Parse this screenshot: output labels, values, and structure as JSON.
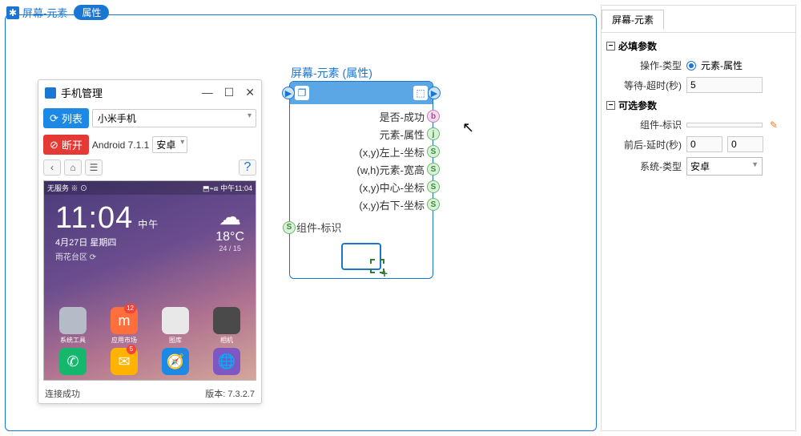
{
  "tab": {
    "label": "屏幕-元素",
    "pill": "属性"
  },
  "phone_window": {
    "title": "手机管理",
    "list_btn": "列表",
    "disconnect_btn": "断开",
    "device_select": "小米手机",
    "os_text": "Android 7.1.1",
    "platform_select": "安卓",
    "footer_status": "连接成功",
    "footer_version": "版本: 7.3.2.7"
  },
  "screen": {
    "status_left": "无服务 ※ ⊙",
    "status_right": "⬒⌁⧈ 中午11:04",
    "time": "11:04",
    "ampm": "中午",
    "date": "4月27日 星期四",
    "location": "雨花台区 ⟳",
    "temp": "18°C",
    "temp_range": "24 / 15",
    "apps_row1": [
      {
        "label": "系统工具",
        "color": "#b5bcc7",
        "badge": ""
      },
      {
        "label": "应用市场",
        "color": "#ff6f3c",
        "badge": "12",
        "text": "m"
      },
      {
        "label": "图库",
        "color": "#e8e8e8",
        "badge": ""
      },
      {
        "label": "相机",
        "color": "#4a4a4a",
        "badge": ""
      }
    ],
    "apps_row2": [
      {
        "label": "",
        "color": "#15b76c",
        "badge": "",
        "icon": "phone"
      },
      {
        "label": "",
        "color": "#ffb300",
        "badge": "5",
        "icon": "msg"
      },
      {
        "label": "",
        "color": "#1e88e5",
        "badge": "",
        "icon": "browser"
      },
      {
        "label": "",
        "color": "#7e57c2",
        "badge": "",
        "icon": "globe"
      }
    ]
  },
  "node": {
    "title": "屏幕-元素 (属性)",
    "outputs": [
      {
        "label": "是否-成功",
        "type": "b"
      },
      {
        "label": "元素-属性",
        "type": "j"
      },
      {
        "label": "(x,y)左上-坐标",
        "type": "S"
      },
      {
        "label": "(w,h)元素-宽高",
        "type": "S"
      },
      {
        "label": "(x,y)中心-坐标",
        "type": "S"
      },
      {
        "label": "(x,y)右下-坐标",
        "type": "S"
      }
    ],
    "input_label": "组件-标识"
  },
  "props": {
    "tab": "屏幕-元素",
    "required_section": "必填参数",
    "optional_section": "可选参数",
    "operation_type_label": "操作-类型",
    "operation_type_value": "元素-属性",
    "wait_timeout_label": "等待-超时(秒)",
    "wait_timeout_value": "5",
    "component_id_label": "组件-标识",
    "component_id_value": "",
    "delay_label": "前后-延时(秒)",
    "delay_before": "0",
    "delay_after": "0",
    "system_type_label": "系统-类型",
    "system_type_value": "安卓"
  }
}
